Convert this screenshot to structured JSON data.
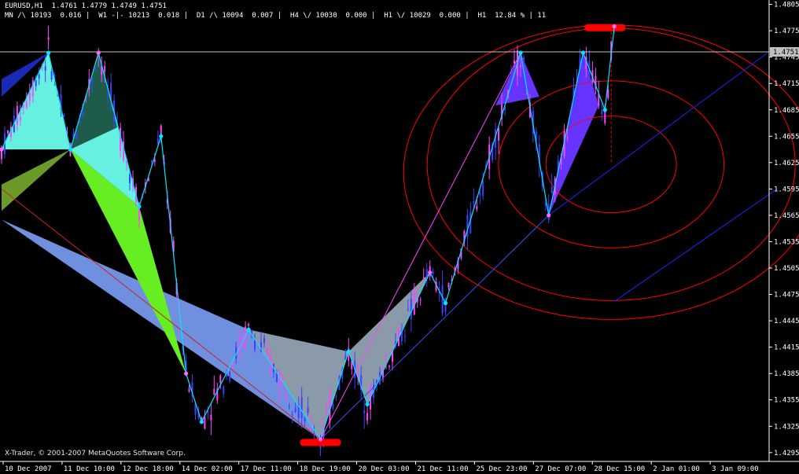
{
  "header": {
    "line1": "EURUSD,H1  1.4761 1.4779 1.4749 1.4751",
    "line2": "MN /\\ 10193  0.016 |  W1 -|- 10213  0.018 |  D1 /\\ 10094  0.007 |  H4 \\/ 10030  0.000 |  H1 \\/ 10029  0.000 |  H1  12.84 % | 11"
  },
  "footer": {
    "copyright": "X-Trader, © 2001-2007 MetaQuotes Software Corp."
  },
  "colors": {
    "background": "#000000",
    "axis": "#ffffff",
    "candle_up": "#3f3fff",
    "candle_down": "#ff44ff",
    "fib_circle": "#ff0000",
    "channel": "#2020ff",
    "bid_line": "#c0c0c0",
    "bid_box": "#c0c0c0",
    "pivot_mark": "#ff0000",
    "zigzag": "#00e5ff",
    "tri_slate": "#6f8fdf",
    "tri_lime": "#66ee22",
    "tri_aqua": "#66f0e0",
    "tri_teal_dark": "#1e5b4a",
    "tri_olive": "#6a9a2a",
    "tri_gray": "#8a9aa8",
    "tri_violet": "#6633ff",
    "tri_navy": "#1a2ab8"
  },
  "chart_data": {
    "type": "candlestick",
    "symbol": "EURUSD",
    "timeframe": "H1",
    "ylim": [
      1.4285,
      1.481
    ],
    "y_ticks": [
      "1.4805",
      "1.4775",
      "1.4745",
      "1.4715",
      "1.4685",
      "1.4655",
      "1.4625",
      "1.4595",
      "1.4565",
      "1.4535",
      "1.4505",
      "1.4475",
      "1.4445",
      "1.4415",
      "1.4385",
      "1.4355",
      "1.4325",
      "1.4295"
    ],
    "bid_label": "1.4751",
    "bid": 1.4751,
    "x_ticks": [
      "10 Dec 2007",
      "11 Dec 10:00",
      "12 Dec 18:00",
      "14 Dec 02:00",
      "17 Dec 11:00",
      "18 Dec 19:00",
      "20 Dec 03:00",
      "21 Dec 11:00",
      "25 Dec 23:00",
      "27 Dec 07:00",
      "28 Dec 15:00",
      "2 Jan 01:00",
      "3 Jan 09:00"
    ],
    "grid": false,
    "zigzag": [
      {
        "i": 0,
        "p": 1.464
      },
      {
        "i": 15,
        "p": 1.475
      },
      {
        "i": 22,
        "p": 1.464
      },
      {
        "i": 31,
        "p": 1.475
      },
      {
        "i": 44,
        "p": 1.4575
      },
      {
        "i": 51,
        "p": 1.4655
      },
      {
        "i": 59,
        "p": 1.4385
      },
      {
        "i": 64,
        "p": 1.433
      },
      {
        "i": 79,
        "p": 1.4435
      },
      {
        "i": 102,
        "p": 1.431
      },
      {
        "i": 111,
        "p": 1.441
      },
      {
        "i": 117,
        "p": 1.435
      },
      {
        "i": 137,
        "p": 1.45
      },
      {
        "i": 142,
        "p": 1.4465
      },
      {
        "i": 166,
        "p": 1.475
      },
      {
        "i": 175,
        "p": 1.4565
      },
      {
        "i": 186,
        "p": 1.475
      },
      {
        "i": 193,
        "p": 1.4685
      },
      {
        "i": 196,
        "p": 1.478
      }
    ],
    "triangles": [
      {
        "name": "slate",
        "points": [
          [
            0,
            1.456
          ],
          [
            79,
            1.4435
          ],
          [
            102,
            1.431
          ]
        ]
      },
      {
        "name": "lime",
        "points": [
          [
            22,
            1.464
          ],
          [
            44,
            1.4575
          ],
          [
            59,
            1.4385
          ]
        ]
      },
      {
        "name": "aqua",
        "points": [
          [
            0,
            1.464
          ],
          [
            15,
            1.475
          ],
          [
            22,
            1.464
          ]
        ]
      },
      {
        "name": "aqua",
        "points": [
          [
            22,
            1.464
          ],
          [
            31,
            1.475
          ],
          [
            44,
            1.4575
          ]
        ]
      },
      {
        "name": "teal_dark",
        "points": [
          [
            22,
            1.464
          ],
          [
            31,
            1.475
          ],
          [
            37,
            1.4665
          ]
        ]
      },
      {
        "name": "olive",
        "points": [
          [
            0,
            1.457
          ],
          [
            22,
            1.464
          ],
          [
            0,
            1.46
          ]
        ]
      },
      {
        "name": "gray",
        "points": [
          [
            79,
            1.4435
          ],
          [
            102,
            1.431
          ],
          [
            111,
            1.441
          ]
        ]
      },
      {
        "name": "gray",
        "points": [
          [
            111,
            1.441
          ],
          [
            117,
            1.435
          ],
          [
            137,
            1.45
          ]
        ]
      },
      {
        "name": "violet",
        "points": [
          [
            158,
            1.469
          ],
          [
            166,
            1.475
          ],
          [
            172,
            1.47
          ]
        ]
      },
      {
        "name": "violet",
        "points": [
          [
            175,
            1.4565
          ],
          [
            186,
            1.475
          ],
          [
            191,
            1.469
          ]
        ]
      },
      {
        "name": "navy",
        "points": [
          [
            0,
            1.47
          ],
          [
            15,
            1.475
          ],
          [
            0,
            1.472
          ]
        ]
      }
    ],
    "fib_circles": {
      "center_i": 195,
      "center_p": 1.4623,
      "radii_p": [
        0.0055,
        0.0095,
        0.0155
      ]
    },
    "channel": [
      {
        "i1": 175,
        "p1": 1.4565,
        "i2": 245,
        "p2": 1.475
      },
      {
        "i1": 196,
        "p1": 1.4467,
        "i2": 248,
        "p2": 1.4595
      }
    ],
    "pivots": [
      {
        "i": 102,
        "p": 1.4307,
        "label": "low"
      },
      {
        "i": 193,
        "p": 1.4779,
        "label": "high"
      }
    ]
  }
}
